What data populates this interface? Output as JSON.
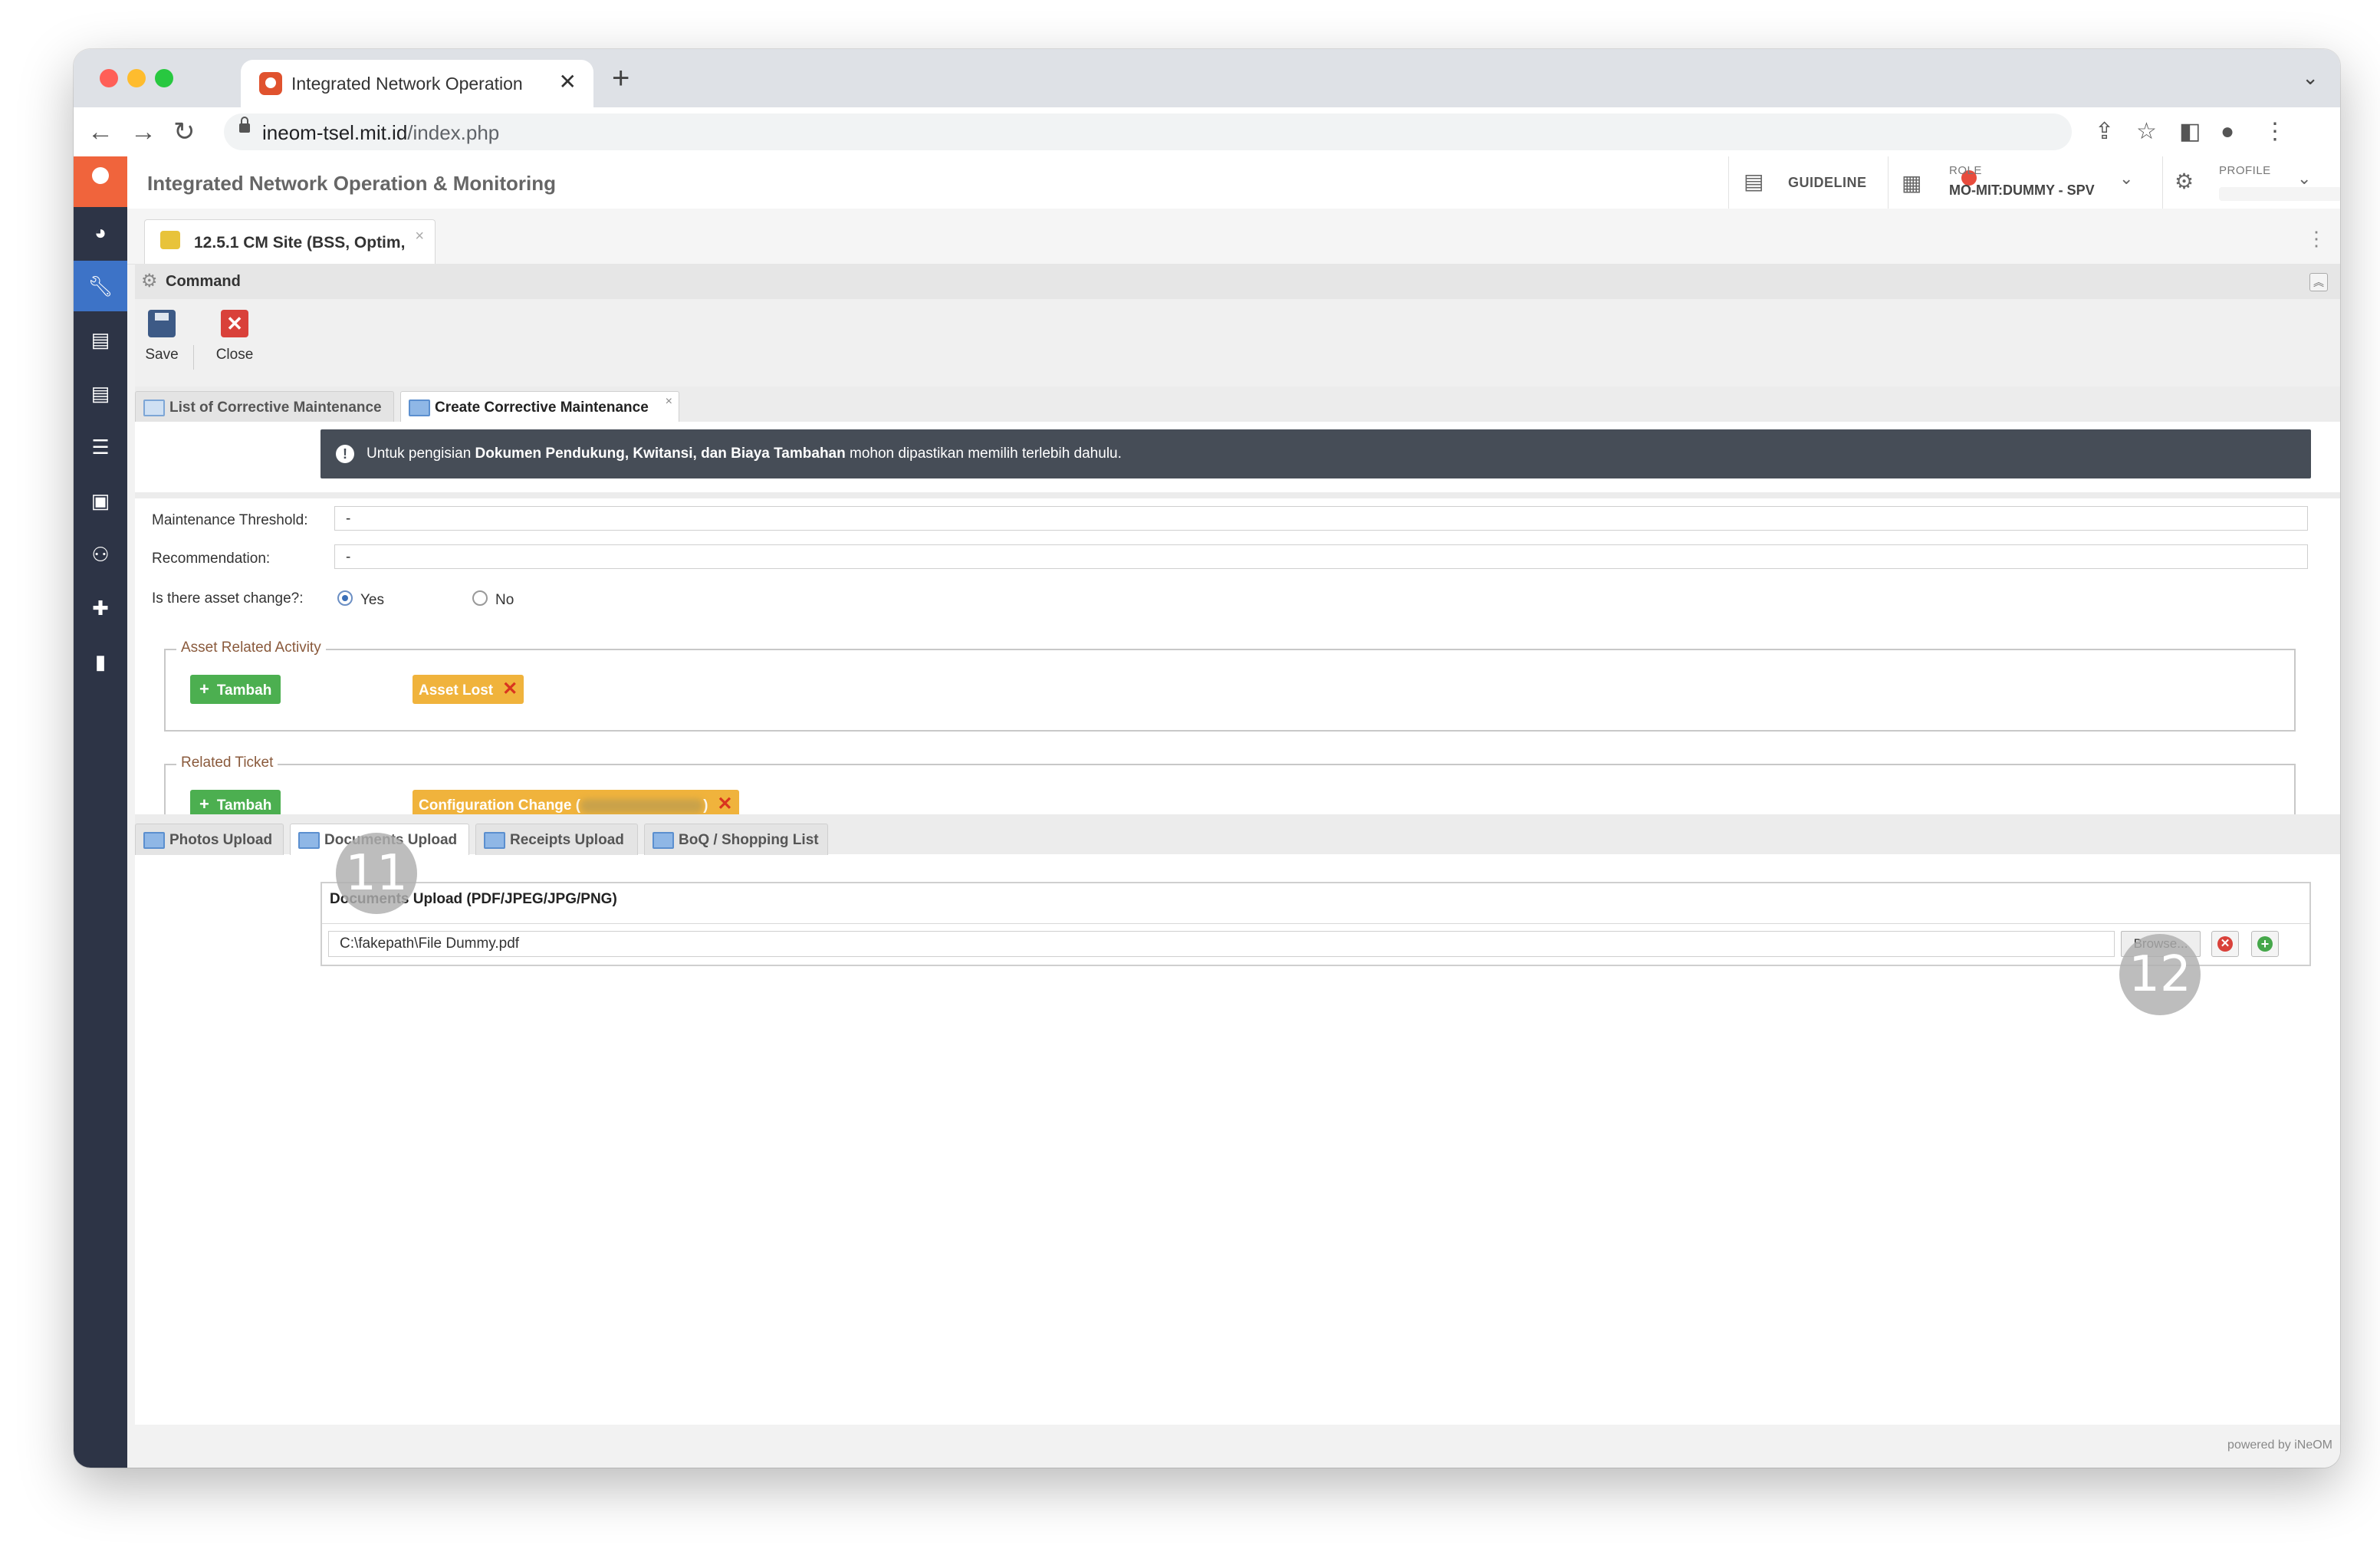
{
  "browser": {
    "tab_title": "Integrated Network Operation",
    "tab_close": "✕",
    "new_tab": "+",
    "url_host": "ineom-tsel.mit.id",
    "url_path": "/index.php"
  },
  "app": {
    "title": "Integrated Network Operation & Monitoring",
    "guideline_label": "GUIDELINE",
    "role_caption": "ROLE",
    "role_value": "MO-MIT:DUMMY - SPV",
    "profile_caption": "PROFILE"
  },
  "page_tab": {
    "title": "12.5.1 CM Site (BSS, Optim,",
    "close": "×"
  },
  "command": {
    "title": "Command",
    "save_label": "Save",
    "close_label": "Close"
  },
  "subtabs": {
    "list_label": "List of Corrective Maintenance",
    "create_label": "Create Corrective Maintenance",
    "close": "×"
  },
  "alert": {
    "prefix": "Untuk pengisian ",
    "bold": "Dokumen Pendukung, Kwitansi, dan Biaya Tambahan",
    "suffix": " mohon dipastikan memilih terlebih dahulu."
  },
  "form": {
    "threshold_label": "Maintenance Threshold:",
    "threshold_value": "-",
    "recommendation_label": "Recommendation:",
    "recommendation_value": "-",
    "asset_change_label": "Is there asset change?:",
    "yes_label": "Yes",
    "no_label": "No",
    "asset_change_selected": "Yes"
  },
  "asset_related": {
    "legend": "Asset Related Activity",
    "add_label": "Tambah",
    "chip_label": "Asset Lost"
  },
  "related_ticket": {
    "legend": "Related Ticket",
    "add_label": "Tambah",
    "chip_prefix": "Configuration Change (",
    "chip_suffix": ")"
  },
  "upload_tabs": {
    "photos": "Photos Upload",
    "documents": "Documents Upload",
    "receipts": "Receipts Upload",
    "boq": "BoQ / Shopping List"
  },
  "documents_upload": {
    "title": "Documents Upload (PDF/JPEG/JPG/PNG)",
    "file_value": "C:\\fakepath\\File Dummy.pdf",
    "browse_label": "Browse..."
  },
  "steps": {
    "step_11": "11",
    "step_12": "12"
  },
  "footer": {
    "powered": "powered by iNeOM"
  },
  "colors": {
    "sidebar": "#2d3446",
    "sidebar_active": "#3d73c7",
    "brand_orange": "#f0643c",
    "alert_bg": "#464d57",
    "green_button": "#4caf50",
    "chip_yellow": "#f0b33c"
  }
}
